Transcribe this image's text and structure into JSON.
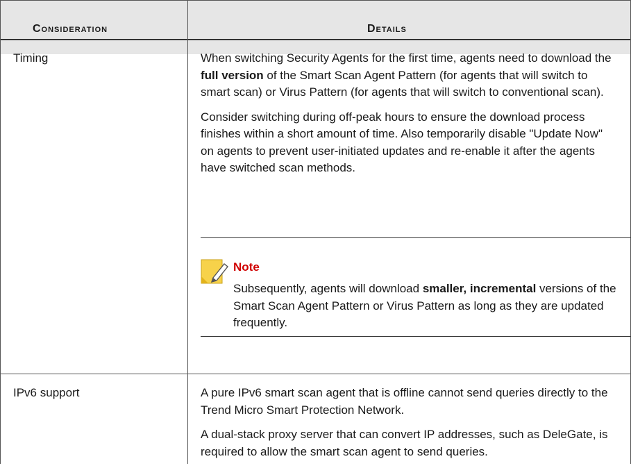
{
  "header": {
    "col1": "Consideration",
    "col2": "Details"
  },
  "rows": [
    {
      "consideration": "Timing",
      "para1_a": "When switching Security Agents for the first time, agents need to download the ",
      "para1_bold": "full version",
      "para1_b": " of the Smart Scan Agent Pattern (for agents that will switch to smart scan) or Virus Pattern (for agents that will switch to conventional scan).",
      "para2": "Consider switching during off-peak hours to ensure the download process finishes within a short amount of time. Also temporarily disable \"Update Now\" on agents to prevent user-initiated updates and re-enable it after the agents have switched scan methods.",
      "note": {
        "title": "Note",
        "text_a": "Subsequently, agents will download ",
        "text_bold": "smaller, incremental",
        "text_b": " versions of the Smart Scan Agent Pattern or Virus Pattern as long as they are updated frequently."
      }
    },
    {
      "consideration": "IPv6 support",
      "para1": "A pure IPv6 smart scan agent that is offline cannot send queries directly to the Trend Micro Smart Protection Network.",
      "para2": "A dual-stack proxy server that can convert IP addresses, such as DeleGate, is required to allow the smart scan agent to send queries."
    }
  ],
  "colors": {
    "header_bg": "#e6e6e6",
    "note_title": "#d00000",
    "note_icon": "#f5c518"
  }
}
